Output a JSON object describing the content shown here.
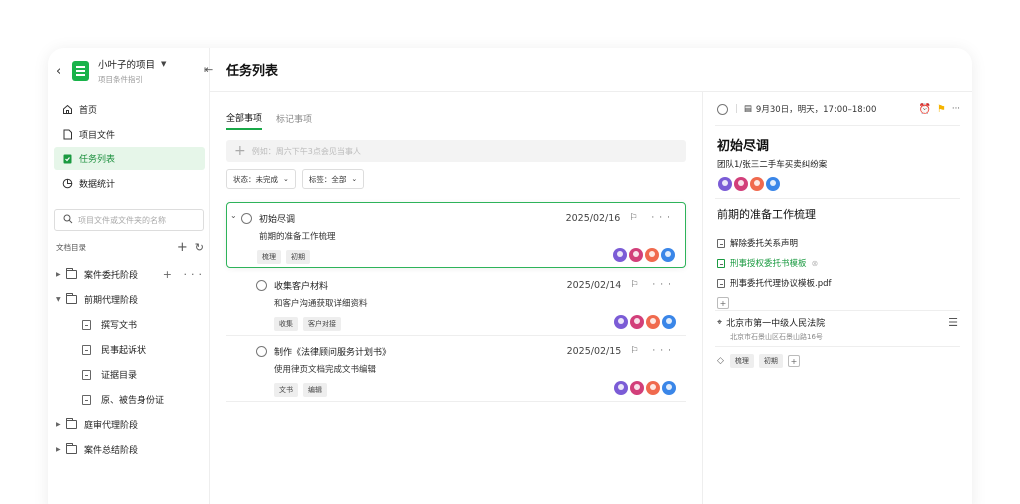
{
  "project": {
    "name": "小叶子的项目",
    "subtitle": "项目条件指引"
  },
  "nav": [
    {
      "label": "首页",
      "icon": "home-icon"
    },
    {
      "label": "项目文件",
      "icon": "file-icon"
    },
    {
      "label": "任务列表",
      "icon": "task-icon",
      "active": true
    },
    {
      "label": "数据统计",
      "icon": "chart-icon"
    }
  ],
  "search": {
    "placeholder": "项目文件或文件夹的名称"
  },
  "tree": {
    "heading": "文档目录",
    "nodes": [
      {
        "label": "案件委托阶段",
        "type": "folder",
        "expanded": false
      },
      {
        "label": "前期代理阶段",
        "type": "folder",
        "expanded": true
      },
      {
        "label": "撰写文书",
        "type": "doc"
      },
      {
        "label": "民事起诉状",
        "type": "doc"
      },
      {
        "label": "证据目录",
        "type": "doc"
      },
      {
        "label": "原、被告身份证",
        "type": "doc"
      },
      {
        "label": "庭审代理阶段",
        "type": "folder",
        "expanded": false
      },
      {
        "label": "案件总结阶段",
        "type": "folder",
        "expanded": false
      }
    ]
  },
  "header": {
    "title": "任务列表"
  },
  "tabs": [
    {
      "label": "全部事项",
      "active": true
    },
    {
      "label": "标记事项"
    }
  ],
  "quick_add": {
    "placeholder": "例如：周六下午3点会见当事人"
  },
  "filters": [
    {
      "label": "状态：未完成"
    },
    {
      "label": "标签：全部"
    }
  ],
  "avatar_colors": [
    "#7b5cd6",
    "#d23f7a",
    "#f06a4e",
    "#3a86e8"
  ],
  "tasks": [
    {
      "title": "初始尽调",
      "date": "2025/02/16",
      "desc": "前期的准备工作梳理",
      "tags": [
        "梳理",
        "初期"
      ],
      "selected": true
    },
    {
      "title": "收集客户材料",
      "date": "2025/02/14",
      "desc": "和客户沟通获取详细资料",
      "tags": [
        "收集",
        "客户对接"
      ]
    },
    {
      "title": "制作《法律顾问服务计划书》",
      "date": "2025/02/15",
      "desc": "使用律页文档完成文书编辑",
      "tags": [
        "文书",
        "编辑"
      ]
    }
  ],
  "detail": {
    "due": "9月30日，明天，17:00–18:00",
    "flag_color": "#f5b400",
    "title": "初始尽调",
    "subtitle": "团队1/张三二手车买卖纠纷案",
    "section": "前期的准备工作梳理",
    "files": [
      {
        "label": "解除委托关系声明",
        "link": false
      },
      {
        "label": "刑事授权委托书模板",
        "link": true
      },
      {
        "label": "刑事委托代理协议模板.pdf",
        "link": false
      }
    ],
    "address": {
      "name": "北京市第一中级人民法院",
      "detail": "北京市石景山区石景山路16号"
    },
    "tags": [
      "梳理",
      "初期"
    ]
  }
}
